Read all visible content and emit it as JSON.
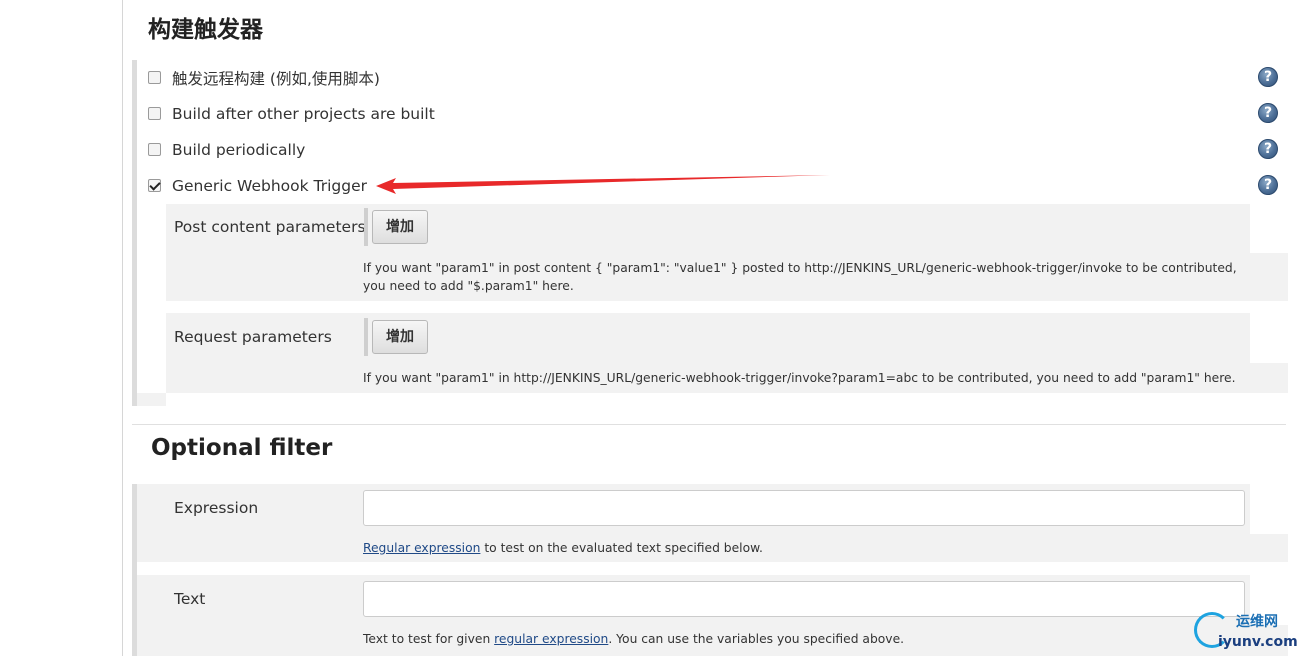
{
  "triggers_section": {
    "title": "构建触发器",
    "options": [
      {
        "label": "触发远程构建 (例如,使用脚本)",
        "checked": false
      },
      {
        "label": "Build after other projects are built",
        "checked": false
      },
      {
        "label": "Build periodically",
        "checked": false
      },
      {
        "label": "Generic Webhook Trigger",
        "checked": true
      }
    ],
    "help_icon_glyph": "?"
  },
  "generic_webhook": {
    "post_content": {
      "label": "Post content parameters",
      "add_button": "增加",
      "help": "If you want \"param1\" in post content { \"param1\": \"value1\" } posted to http://JENKINS_URL/generic-webhook-trigger/invoke to be contributed, you need to add \"$.param1\" here."
    },
    "request_params": {
      "label": "Request parameters",
      "add_button": "增加",
      "help": "If you want \"param1\" in http://JENKINS_URL/generic-webhook-trigger/invoke?param1=abc to be contributed, you need to add \"param1\" here."
    }
  },
  "optional_filter": {
    "title": "Optional filter",
    "expression": {
      "label": "Expression",
      "value": "",
      "help_link": "Regular expression",
      "help_rest": " to test on the evaluated text specified below."
    },
    "text": {
      "label": "Text",
      "value": "",
      "help_before": "Text to test for given ",
      "help_link": "regular expression",
      "help_after": ". You can use the variables you specified above."
    }
  },
  "annotation": {
    "arrow_color": "#e8292a"
  },
  "watermark": {
    "cn": "运维网",
    "en": "iyunv.com"
  }
}
